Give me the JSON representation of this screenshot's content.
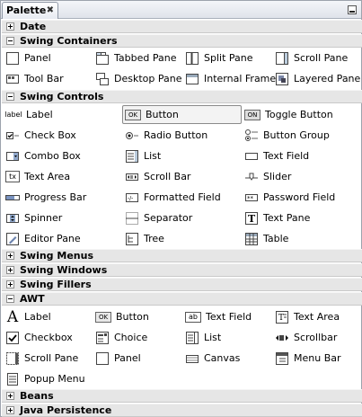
{
  "window": {
    "tab_title": "Palette",
    "tab_close": "✖"
  },
  "sections": {
    "date": "Date",
    "swing_containers": "Swing Containers",
    "swing_controls": "Swing Controls",
    "swing_menus": "Swing Menus",
    "swing_windows": "Swing Windows",
    "swing_fillers": "Swing Fillers",
    "awt": "AWT",
    "beans": "Beans",
    "java_persistence": "Java Persistence"
  },
  "swing_containers": {
    "panel": "Panel",
    "tabbed_pane": "Tabbed Pane",
    "split_pane": "Split Pane",
    "scroll_pane": "Scroll Pane",
    "tool_bar": "Tool Bar",
    "desktop_pane": "Desktop Pane",
    "internal_frame": "Internal Frame",
    "layered_pane": "Layered Pane"
  },
  "swing_controls": {
    "label": "Label",
    "button": "Button",
    "toggle_button": "Toggle Button",
    "check_box": "Check Box",
    "radio_button": "Radio Button",
    "button_group": "Button Group",
    "combo_box": "Combo Box",
    "list": "List",
    "text_field": "Text Field",
    "text_area": "Text Area",
    "scroll_bar": "Scroll Bar",
    "slider": "Slider",
    "progress_bar": "Progress Bar",
    "formatted_field": "Formatted Field",
    "password_field": "Password Field",
    "spinner": "Spinner",
    "separator": "Separator",
    "text_pane": "Text Pane",
    "editor_pane": "Editor Pane",
    "tree": "Tree",
    "table": "Table"
  },
  "awt": {
    "label": "Label",
    "button": "Button",
    "text_field": "Text Field",
    "text_area": "Text Area",
    "checkbox": "Checkbox",
    "choice": "Choice",
    "list": "List",
    "scrollbar": "Scrollbar",
    "scroll_pane": "Scroll Pane",
    "panel": "Panel",
    "canvas": "Canvas",
    "menu_bar": "Menu Bar",
    "popup_menu": "Popup Menu"
  },
  "icon_text": {
    "label": "label",
    "ok": "OK",
    "on": "ON",
    "tx": "tx",
    "ab": "ab",
    "big_a": "A"
  }
}
